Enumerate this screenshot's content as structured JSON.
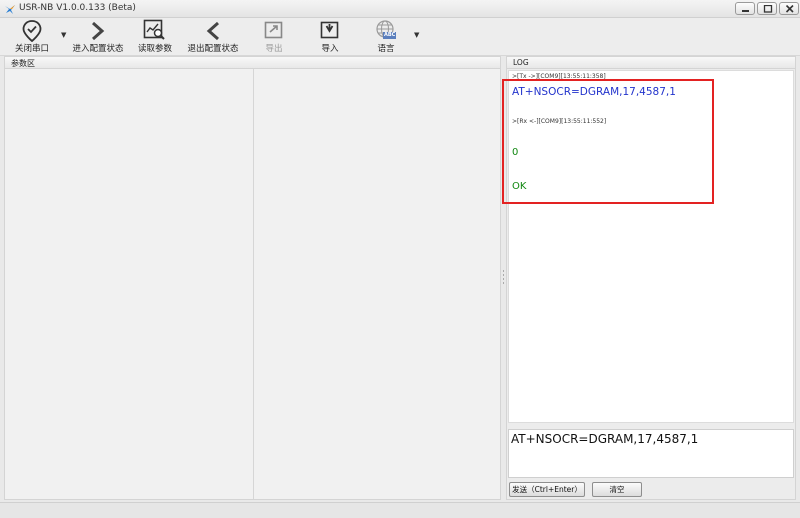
{
  "window": {
    "title": "USR-NB V1.0.0.133 (Beta)"
  },
  "toolbar": {
    "close_port": "关闭串口",
    "enter_config": "进入配置状态",
    "read_params": "读取参数",
    "exit_config": "退出配置状态",
    "export": "导出",
    "import": "导入",
    "language": "语言",
    "language_badge": "ABC"
  },
  "param_panel": {
    "title": "参数区"
  },
  "log_panel": {
    "title": "LOG",
    "lines": [
      ">[Tx ->][COM9][13:55:11:358]",
      "AT+NSOCR=DGRAM,17,4587,1",
      ">[Rx <-][COM9][13:55:11:552]",
      "0",
      "OK"
    ]
  },
  "input": {
    "value": "AT+NSOCR=DGRAM,17,4587,1"
  },
  "buttons": {
    "send": "发送（Ctrl+Enter）",
    "clear": "清空"
  },
  "colors": {
    "tx_text": "#2233cc",
    "rx_text": "#118811",
    "highlight": "#e32222"
  }
}
